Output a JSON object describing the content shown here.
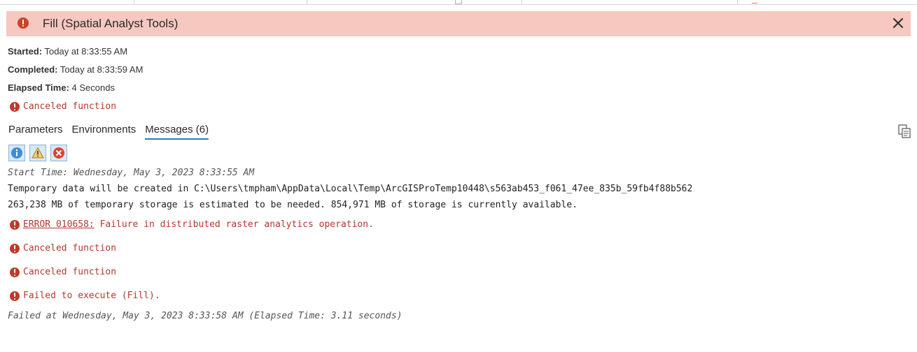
{
  "window": {
    "title": "Fill (Spatial Analyst Tools)",
    "close_icon": "close-icon",
    "status_icon": "error-icon",
    "banner_color": "#f6c8c0"
  },
  "meta": {
    "started_label": "Started:",
    "started_value": "Today at 8:33:55 AM",
    "completed_label": "Completed:",
    "completed_value": "Today at 8:33:59 AM",
    "elapsed_label": "Elapsed Time:",
    "elapsed_value": "4 Seconds"
  },
  "status": {
    "text": "Canceled function",
    "color": "#b03a2e"
  },
  "tabs": [
    {
      "label": "Parameters",
      "active": false
    },
    {
      "label": "Environments",
      "active": false
    },
    {
      "label": "Messages (6)",
      "active": true
    }
  ],
  "filters": [
    {
      "icon": "info-icon",
      "active": true
    },
    {
      "icon": "warning-icon",
      "active": true
    },
    {
      "icon": "error-icon",
      "active": true
    }
  ],
  "copy_icon": "copy-messages-icon",
  "messages": [
    {
      "type": "start",
      "text": "Start Time: Wednesday, May 3, 2023 8:33:55 AM"
    },
    {
      "type": "info",
      "text": "Temporary data will be created in C:\\Users\\tmpham\\AppData\\Local\\Temp\\ArcGISProTemp10448\\s563ab453_f061_47ee_835b_59fb4f88b562"
    },
    {
      "type": "info",
      "text": "263,238 MB of temporary storage is estimated to be needed. 854,971 MB of storage is currently available."
    },
    {
      "type": "error",
      "code": "ERROR 010658:",
      "text": " Failure in distributed raster analytics operation."
    },
    {
      "type": "error",
      "text": "Canceled function"
    },
    {
      "type": "error",
      "text": "Canceled function"
    },
    {
      "type": "error",
      "text": "Failed to execute (Fill)."
    },
    {
      "type": "end",
      "text": "Failed at Wednesday, May 3, 2023 8:33:58 AM (Elapsed Time: 3.11 seconds)"
    }
  ]
}
